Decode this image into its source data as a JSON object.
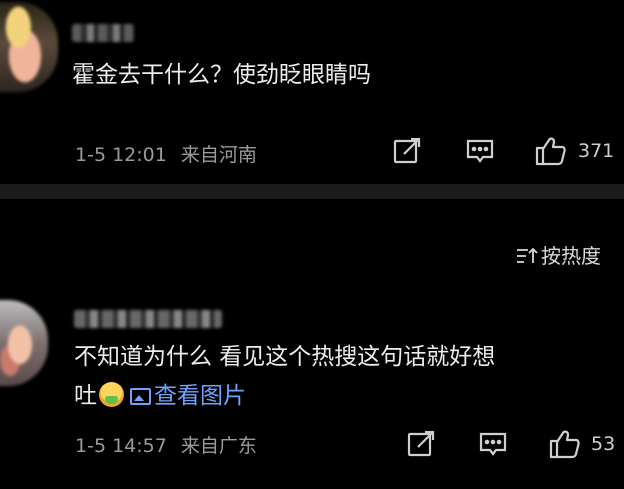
{
  "comments": [
    {
      "text": "霍金去干什么？使劲眨眼睛吗",
      "time": "1-5 12:01",
      "location": "来自河南",
      "likes": "371"
    },
    {
      "text_line1": "不知道为什么 看见这个热搜这句话就好想",
      "text_line2": "吐",
      "emoji": "nauseated-face",
      "view_image": "查看图片",
      "time": "1-5 14:57",
      "location": "来自广东",
      "likes": "53"
    }
  ],
  "sort": {
    "label": "按热度"
  },
  "colors": {
    "background": "#000000",
    "link": "#6ea2ff",
    "meta": "#9a9a9a",
    "divider": "#1b1b1b"
  }
}
